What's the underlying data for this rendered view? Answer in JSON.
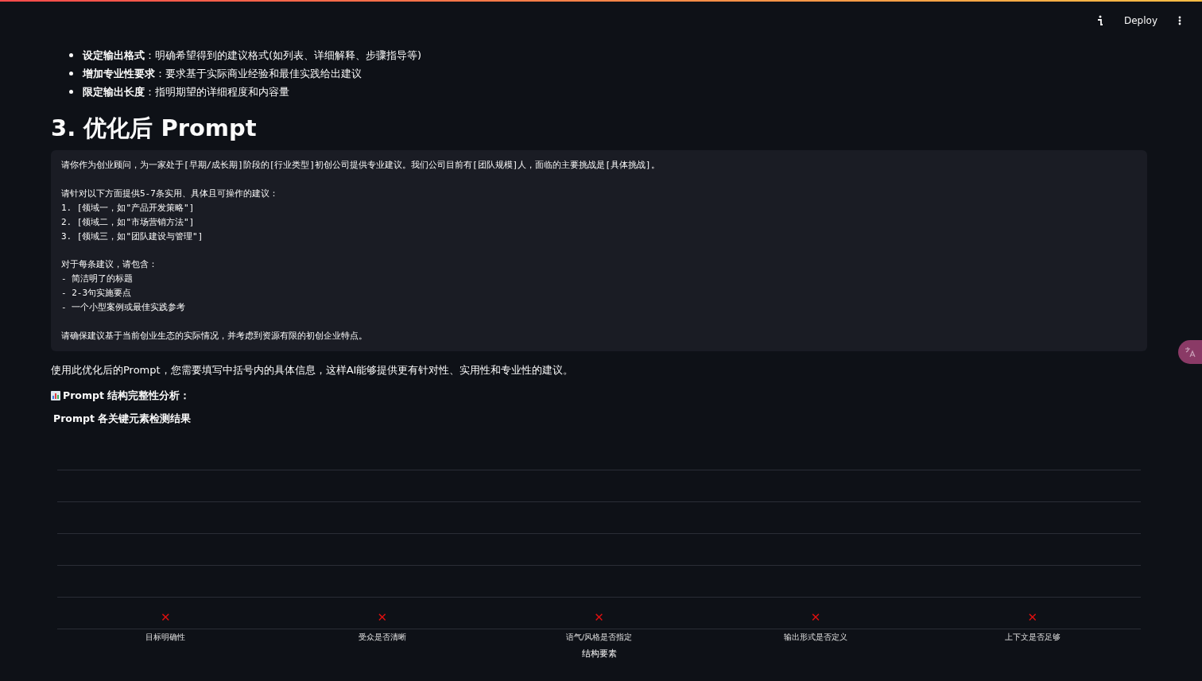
{
  "header": {
    "deploy_label": "Deploy"
  },
  "bullets": [
    {
      "term": "设定输出格式",
      "text": "：明确希望得到的建议格式(如列表、详细解释、步骤指导等)"
    },
    {
      "term": "增加专业性要求",
      "text": "：要求基于实际商业经验和最佳实践给出建议"
    },
    {
      "term": "限定输出长度",
      "text": "：指明期望的详细程度和内容量"
    }
  ],
  "heading": "3. 优化后 Prompt",
  "code_paragraphs": [
    [
      "请你作为创业顾问，为一家处于[早期/成长期]阶段的[行业类型]初创公司提供专业建议。我们公司目前有[团队规模]人，面临的主要挑战是[具体挑战]。"
    ],
    [
      "请针对以下方面提供5-7条实用、具体且可操作的建议：",
      "1. [领域一，如\"产品开发策略\"]",
      "2. [领域二，如\"市场营销方法\"]",
      "3. [领域三，如\"团队建设与管理\"]"
    ],
    [
      "对于每条建议，请包含：",
      "- 简洁明了的标题",
      "- 2-3句实施要点",
      "- 一个小型案例或最佳实践参考"
    ],
    [
      "请确保建议基于当前创业生态的实际情况，并考虑到资源有限的初创企业特点。"
    ]
  ],
  "note": "使用此优化后的Prompt，您需要填写中括号内的具体信息，这样AI能够提供更有针对性、实用性和专业性的建议。",
  "analysis_title": "Prompt 结构完整性分析：",
  "chart": {
    "title": "Prompt 各关键元素检测结果",
    "xlabel": "结构要素",
    "categories": [
      {
        "label": "目标明确性",
        "mark": "✕"
      },
      {
        "label": "受众是否清晰",
        "mark": "✕"
      },
      {
        "label": "语气/风格是否指定",
        "mark": "✕"
      },
      {
        "label": "输出形式是否定义",
        "mark": "✕"
      },
      {
        "label": "上下文是否足够",
        "mark": "✕"
      }
    ]
  }
}
